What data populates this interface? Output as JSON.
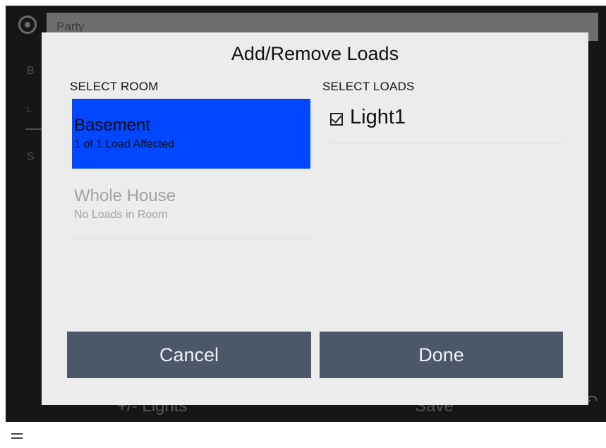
{
  "background": {
    "scene_field_value": "Party",
    "side_texts": [
      "B",
      "L",
      "S"
    ],
    "bottom_left_label": "+/- Lights",
    "bottom_right_label": "Save",
    "top_icon": "scene-icon",
    "undo_icon": "undo-icon"
  },
  "dialog": {
    "title": "Add/Remove Loads",
    "select_room_label": "SELECT ROOM",
    "select_loads_label": "SELECT LOADS",
    "rooms": [
      {
        "name": "Basement",
        "sub": "1 of 1 Load Affected",
        "selected": true
      },
      {
        "name": "Whole House",
        "sub": "No Loads in Room",
        "selected": false
      }
    ],
    "loads": [
      {
        "label": "Light1",
        "checked": true
      }
    ],
    "cancel_label": "Cancel",
    "done_label": "Done"
  },
  "colors": {
    "selected_room": "#0047ff",
    "button": "#4c5869",
    "dialog_bg": "#ececec"
  },
  "footer": {
    "menu_icon": "hamburger-menu-icon"
  }
}
